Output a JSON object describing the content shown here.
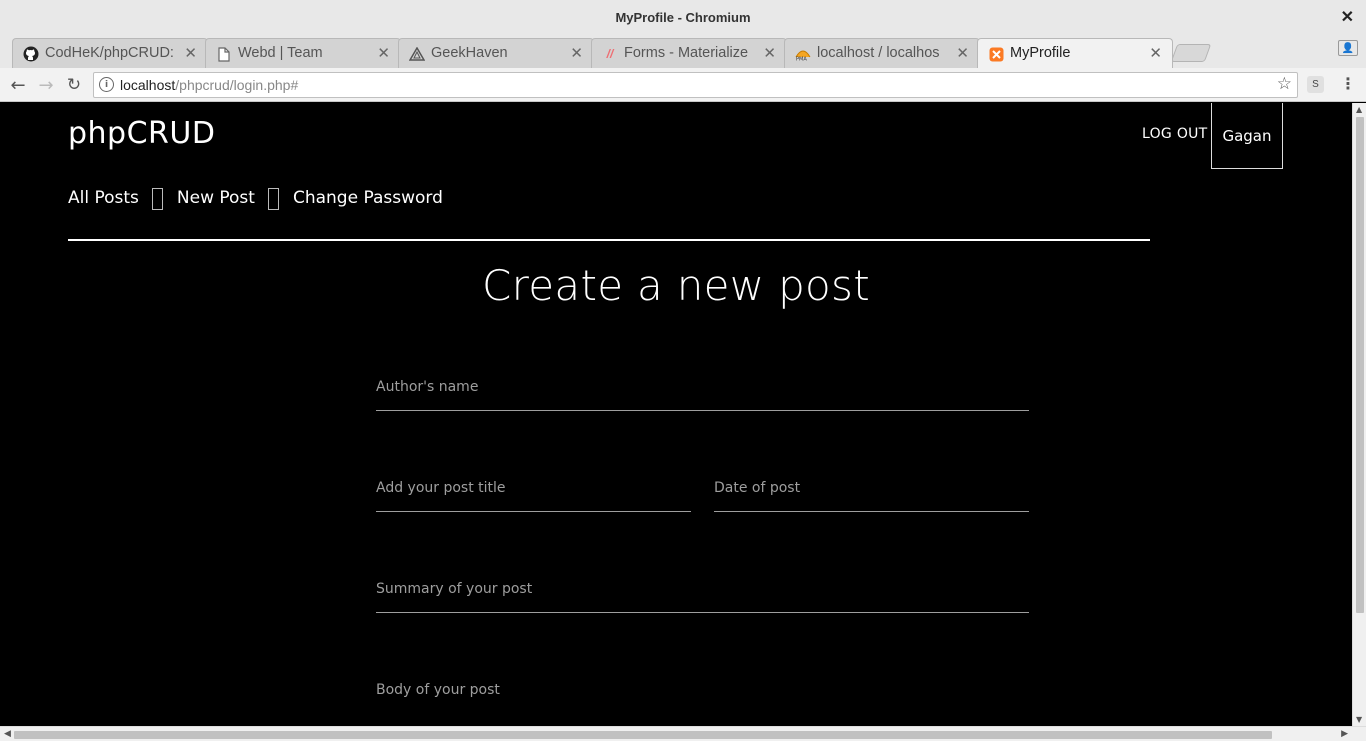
{
  "window": {
    "title": "MyProfile - Chromium"
  },
  "tabs": [
    {
      "label": "CodHeK/phpCRUD:",
      "icon": "github-icon"
    },
    {
      "label": "Webd | Team",
      "icon": "page-icon"
    },
    {
      "label": "GeekHaven",
      "icon": "geekhaven-icon"
    },
    {
      "label": "Forms - Materialize",
      "icon": "materialize-icon"
    },
    {
      "label": "localhost / localhos",
      "icon": "phpmyadmin-icon"
    },
    {
      "label": "MyProfile",
      "icon": "xampp-icon"
    }
  ],
  "toolbar": {
    "url_host": "localhost",
    "url_path": "/phpcrud/login.php#",
    "extension_label": "S",
    "profile_label": "👤"
  },
  "app": {
    "brand": "phpCRUD",
    "logout": "LOG OUT",
    "user": "Gagan"
  },
  "subnav": {
    "items": [
      "All Posts",
      "New Post",
      "Change Password"
    ]
  },
  "form": {
    "title": "Create a new post",
    "author_label": "Author's name",
    "post_title_label": "Add your post title",
    "date_label": "Date of post",
    "summary_label": "Summary of your post",
    "body_label": "Body of your post"
  },
  "colors": {
    "page_background": "#000000",
    "label_gray": "#9e9e9e",
    "text_white": "#ffffff"
  }
}
